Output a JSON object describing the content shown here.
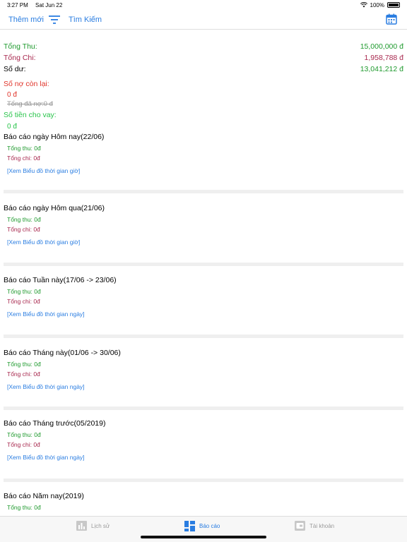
{
  "status": {
    "time": "3:27 PM",
    "date": "Sat Jun 22",
    "battery": "100%"
  },
  "nav": {
    "add_label": "Thêm mới",
    "search_label": "Tìm Kiếm"
  },
  "summary": {
    "income_label": "Tổng Thu:",
    "income_value": "15,000,000 đ",
    "expense_label": "Tổng Chi:",
    "expense_value": "1,958,788 đ",
    "balance_label": "Số dư:",
    "balance_value": "13,041,212 đ"
  },
  "debt": {
    "title": "Số nợ còn lại:",
    "remaining": "0 đ",
    "paid": "Tổng đã nợ:0 đ"
  },
  "loan": {
    "title": "Số tiền cho vay:",
    "value": "0 đ"
  },
  "reports": [
    {
      "title": "Báo cáo ngày Hôm nay(22/06)",
      "income": "Tổng thu: 0đ",
      "expense": "Tổng chi: 0đ",
      "link": "[Xem Biểu đồ thời gian giờ]"
    },
    {
      "title": "Báo cáo ngày Hôm qua(21/06)",
      "income": "Tổng thu: 0đ",
      "expense": "Tổng chi: 0đ",
      "link": "[Xem Biểu đồ thời gian giờ]"
    },
    {
      "title": "Báo cáo Tuần này(17/06 -> 23/06)",
      "income": "Tổng thu: 0đ",
      "expense": "Tổng chi: 0đ",
      "link": "[Xem Biểu đồ thời gian ngày]"
    },
    {
      "title": "Báo cáo Tháng này(01/06 -> 30/06)",
      "income": "Tổng thu: 0đ",
      "expense": "Tổng chi: 0đ",
      "link": "[Xem Biểu đồ thời gian ngày]"
    },
    {
      "title": "Báo cáo Tháng trước(05/2019)",
      "income": "Tổng thu: 0đ",
      "expense": "Tổng chi: 0đ",
      "link": "[Xem Biểu đồ thời gian ngày]"
    },
    {
      "title": "Báo cáo Năm nay(2019)",
      "income": "Tổng thu: 0đ"
    }
  ],
  "tabs": {
    "history": "Lịch sử",
    "report": "Báo cáo",
    "account": "Tài khoản"
  },
  "icons": {
    "wifi": "wifi-icon",
    "battery": "battery-icon",
    "filter": "filter-icon",
    "calendar": "calendar-icon",
    "history_tab": "bar-chart-icon",
    "report_tab": "dashboard-icon",
    "account_tab": "wallet-icon"
  },
  "colors": {
    "accent": "#2a7de1",
    "income": "#1f9a2e",
    "expense": "#a8294f",
    "debt": "#e0342a",
    "loan": "#28c44a"
  }
}
